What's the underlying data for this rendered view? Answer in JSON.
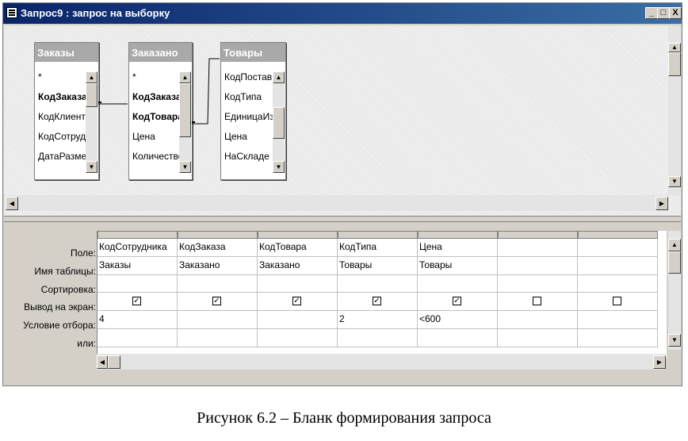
{
  "window": {
    "title": "Запрос9 : запрос на выборку",
    "controls": {
      "minimize": "_",
      "maximize": "□",
      "close": "X"
    }
  },
  "tables": [
    {
      "name": "Заказы",
      "fields": [
        {
          "label": "*",
          "bold": false
        },
        {
          "label": "КодЗаказа",
          "bold": true
        },
        {
          "label": "КодКлиента",
          "bold": false
        },
        {
          "label": "КодСотрудн",
          "bold": false
        },
        {
          "label": "ДатаРазмеща",
          "bold": false
        }
      ]
    },
    {
      "name": "Заказано",
      "fields": [
        {
          "label": "*",
          "bold": false
        },
        {
          "label": "КодЗаказа",
          "bold": true
        },
        {
          "label": "КодТовара",
          "bold": true
        },
        {
          "label": "Цена",
          "bold": false
        },
        {
          "label": "Количество",
          "bold": false
        }
      ]
    },
    {
      "name": "Товары",
      "fields": [
        {
          "label": "КодПоставщ",
          "bold": false
        },
        {
          "label": "КодТипа",
          "bold": false
        },
        {
          "label": "ЕдиницаИзме",
          "bold": false
        },
        {
          "label": "Цена",
          "bold": false
        },
        {
          "label": "НаСкладе",
          "bold": false
        }
      ]
    }
  ],
  "grid": {
    "row_labels": [
      "Поле:",
      "Имя таблицы:",
      "Сортировка:",
      "Вывод на экран:",
      "Условие отбора:",
      "или:"
    ],
    "columns": [
      {
        "field": "КодСотрудника",
        "table": "Заказы",
        "sort": "",
        "show": true,
        "criteria": "4",
        "or": ""
      },
      {
        "field": "КодЗаказа",
        "table": "Заказано",
        "sort": "",
        "show": true,
        "criteria": "",
        "or": ""
      },
      {
        "field": "КодТовара",
        "table": "Заказано",
        "sort": "",
        "show": true,
        "criteria": "",
        "or": ""
      },
      {
        "field": "КодТипа",
        "table": "Товары",
        "sort": "",
        "show": true,
        "criteria": "2",
        "or": ""
      },
      {
        "field": "Цена",
        "table": "Товары",
        "sort": "",
        "show": true,
        "criteria": "<600",
        "or": ""
      },
      {
        "field": "",
        "table": "",
        "sort": "",
        "show": false,
        "criteria": "",
        "or": ""
      },
      {
        "field": "",
        "table": "",
        "sort": "",
        "show": false,
        "criteria": "",
        "or": ""
      }
    ]
  },
  "caption": "Рисунок 6.2 – Бланк формирования запроса"
}
